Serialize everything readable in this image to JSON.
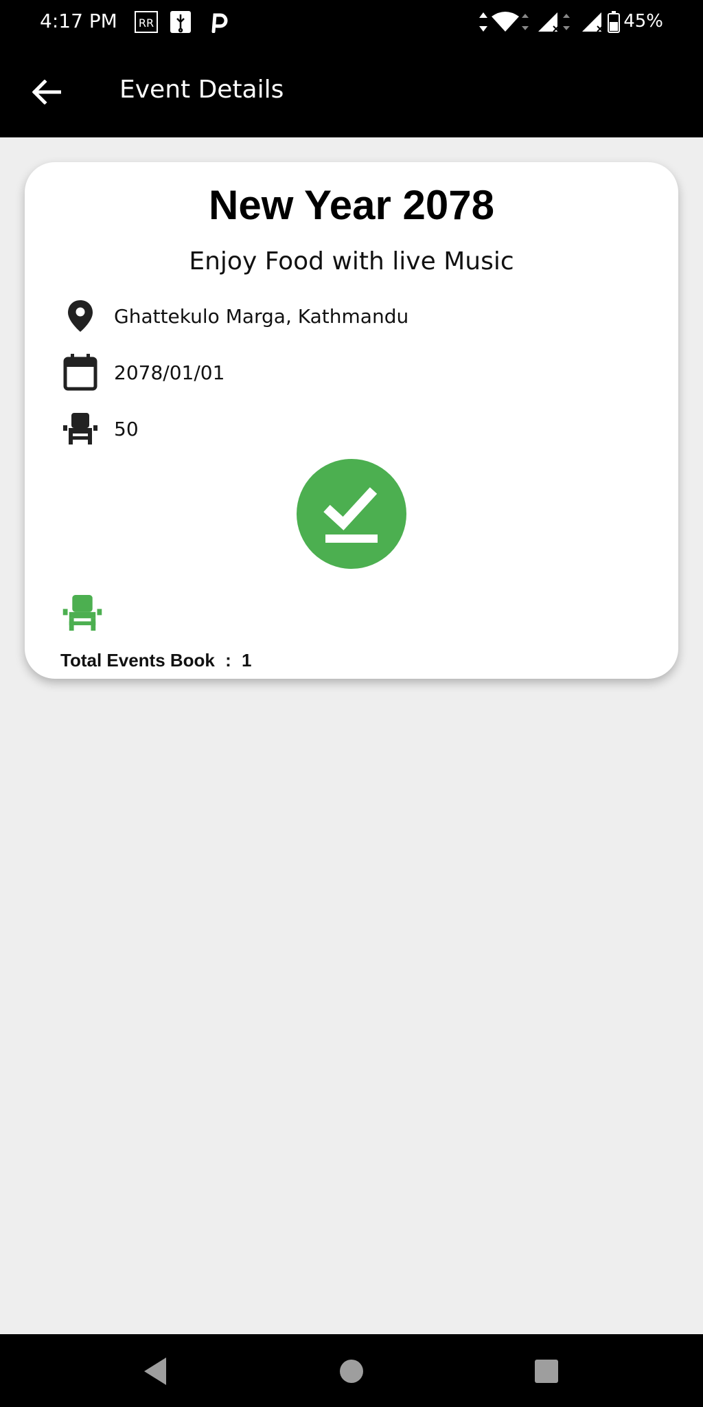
{
  "status_bar": {
    "time": "4:17 PM",
    "battery": "45%",
    "icons": [
      "rr-icon",
      "usb-icon",
      "p-icon",
      "data-arrows-icon",
      "wifi-icon",
      "signal-icon",
      "signal-icon",
      "battery-icon"
    ]
  },
  "app_bar": {
    "title": "Event Details",
    "back_icon": "arrow-left-icon"
  },
  "event": {
    "title": "New Year 2078",
    "subtitle": "Enjoy Food with live Music",
    "location": "Ghattekulo Marga, Kathmandu",
    "date": "2078/01/01",
    "seats": "50",
    "book_icon": "check-download-icon",
    "total_label": "Total Events Book",
    "total_separator": ":",
    "total_value": "1"
  },
  "colors": {
    "accent_green": "#4caf50",
    "app_bar": "#000000",
    "background": "#eeeeee",
    "card": "#ffffff"
  },
  "nav_bar": {
    "icons": [
      "back-triangle-icon",
      "home-circle-icon",
      "recents-square-icon"
    ]
  }
}
